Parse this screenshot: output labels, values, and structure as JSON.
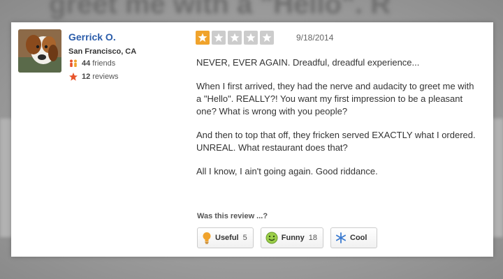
{
  "background": {
    "text": "greet me with a \"Hello\". R"
  },
  "user": {
    "name": "Gerrick O.",
    "location": "San Francisco, CA",
    "friends_count": "44",
    "friends_label": "friends",
    "reviews_count": "12",
    "reviews_label": "reviews"
  },
  "review": {
    "rating": 1,
    "max_rating": 5,
    "date": "9/18/2014",
    "paragraphs": [
      "NEVER, EVER AGAIN.  Dreadful, dreadful experience...",
      "When I first arrived, they had the nerve and audacity to greet me with a \"Hello\".  REALLY?!  You want my first impression to be a pleasant one? What is wrong with you people?",
      "And then to top that off, they fricken served EXACTLY what I ordered.  UNREAL.  What restaurant does that?",
      "All I know, I ain't going again.  Good riddance."
    ]
  },
  "votes": {
    "question": "Was this review ...?",
    "useful": {
      "label": "Useful",
      "count": "5",
      "icon": "lightbulb-icon"
    },
    "funny": {
      "label": "Funny",
      "count": "18",
      "icon": "smiley-icon"
    },
    "cool": {
      "label": "Cool",
      "count": "",
      "icon": "snowflake-icon"
    }
  },
  "colors": {
    "star_filled": "#f0a32c",
    "star_empty": "#cccccc",
    "name_link": "#2a5caa"
  }
}
